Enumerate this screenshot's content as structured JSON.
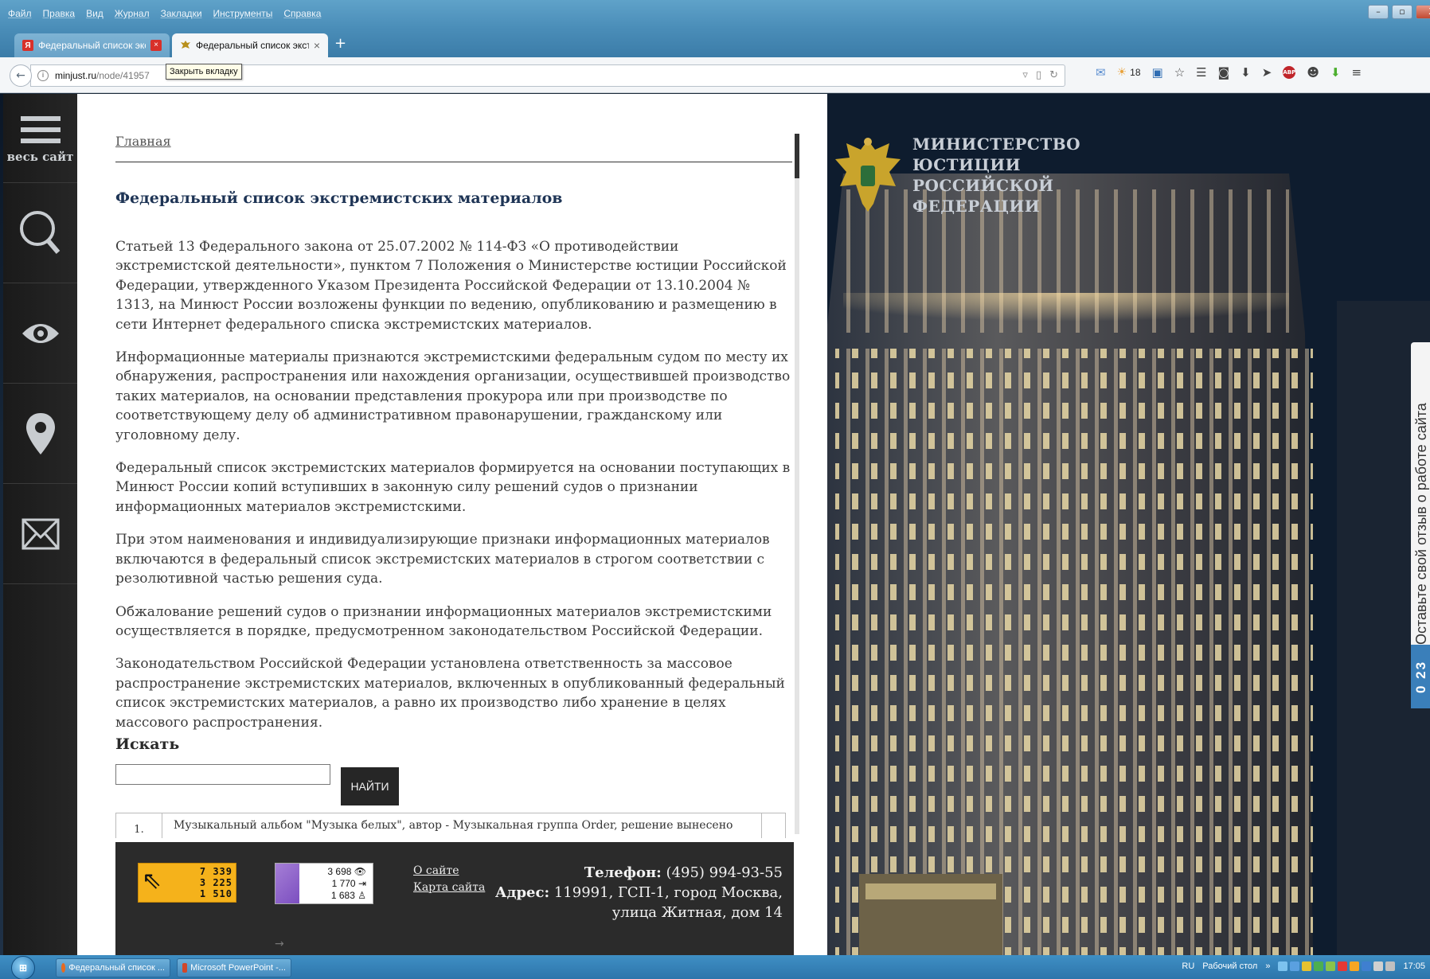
{
  "menubar": {
    "items": [
      "Файл",
      "Правка",
      "Вид",
      "Журнал",
      "Закладки",
      "Инструменты",
      "Справка"
    ],
    "window_controls": {
      "minimize": "–",
      "restore": "▫",
      "close": "X"
    }
  },
  "tabs": [
    {
      "label": "Федеральный список экстр...",
      "favicon": "yandex-icon",
      "close": "×",
      "active": false
    },
    {
      "label": "Федеральный список экстр...",
      "favicon": "eagle-icon",
      "close": "×",
      "active": true
    }
  ],
  "new_tab_label": "+",
  "tooltip": "Закрыть вкладку",
  "address": {
    "domain": "minjust.ru",
    "path": "/node/41957"
  },
  "toolbar": {
    "weather_temp": "18"
  },
  "sidebar": {
    "menu_label": "весь сайт",
    "items": [
      "menu-icon",
      "search-icon",
      "eye-icon",
      "location-pin-icon",
      "mail-icon"
    ]
  },
  "page": {
    "breadcrumb": "Главная",
    "title": "Федеральный список экстремистских материалов",
    "paragraphs": [
      "Статьей 13 Федерального закона от 25.07.2002 № 114-ФЗ «О противодействии экстремистской деятельности», пунктом 7 Положения о Министерстве юстиции Российской Федерации, утвержденного Указом Президента Российской Федерации от 13.10.2004 № 1313, на Минюст России возложены функции по ведению, опубликованию и размещению в сети Интернет федерального списка экстремистских материалов.",
      "Информационные материалы признаются экстремистскими федеральным судом по месту их обнаружения, распространения или нахождения организации, осуществившей производство таких материалов, на основании представления прокурора или при производстве по соответствующему делу об административном правонарушении, гражданскому или уголовному делу.",
      "Федеральный список экстремистских материалов формируется на основании поступающих в Минюст России копий вступивших в законную силу решений судов о признании информационных материалов экстремистскими.",
      "При этом наименования и индивидуализирующие признаки информационных материалов включаются в федеральный список экстремистских материалов в строгом соответствии с резолютивной частью решения суда.",
      "Обжалование решений судов о признании информационных материалов экстремистскими осуществляется в порядке, предусмотренном законодательством Российской Федерации.",
      "Законодательством Российской Федерации установлена ответственность за массовое распространение экстремистских материалов, включенных в опубликованный федеральный список экстремистских материалов, а равно их производство либо хранение в целях массового распространения."
    ],
    "search_label": "Искать",
    "search_value": "",
    "search_button": "НАЙТИ",
    "result_number": "1.",
    "result_text": "Музыкальный альбом \"Музыка белых\", автор - Музыкальная группа Order, решение вынесено"
  },
  "footer": {
    "counter1": [
      "7 339",
      "3 225",
      "1 510"
    ],
    "counter2": [
      "3 698",
      "1 770",
      "1 683"
    ],
    "links": [
      "О сайте",
      "Карта сайта"
    ],
    "phone_label": "Телефон:",
    "phone": "(495) 994-93-55",
    "address_label": "Адрес:",
    "address": "119991, ГСП-1, город Москва, улица Житная, дом 14",
    "arrow": "→"
  },
  "ministry": [
    "МИНИСТЕРСТВО",
    "ЮСТИЦИИ",
    "РОССИЙСКОЙ",
    "ФЕДЕРАЦИИ"
  ],
  "feedback": {
    "badge": "0 23",
    "text": "Оставьте свой отзыв о работе сайта"
  },
  "taskbar": {
    "tasks": [
      "Федеральный список ...",
      "Microsoft PowerPoint -..."
    ],
    "lang": "RU",
    "desktop": "Рабочий стол",
    "desktop_more": "»",
    "clock": "17:05"
  },
  "colors": {
    "title": "#1e3455",
    "footer_bg": "#2b2b2b",
    "accent_badge": "#3a7fba"
  }
}
